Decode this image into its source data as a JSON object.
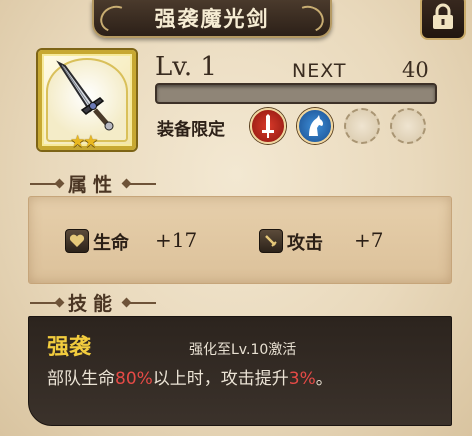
{
  "header": {
    "title": "强袭魔光剑"
  },
  "item": {
    "stars": "★★",
    "level": "Lv. 1",
    "next_label": "NEXT",
    "next_value": "40",
    "exp_progress": 0.0
  },
  "equip": {
    "label": "装备限定",
    "icons": [
      "sword-class-icon",
      "cavalry-class-icon",
      "empty-slot-icon",
      "empty-slot-icon"
    ]
  },
  "attributes": {
    "heading": "属性",
    "hp": {
      "name": "生命",
      "value": "+17"
    },
    "attack": {
      "name": "攻击",
      "value": "+7"
    }
  },
  "skill": {
    "heading": "技能",
    "name": "强袭",
    "unlock": "强化至Lv.10激活",
    "desc_part1": "部队生命",
    "desc_hl1": "80%",
    "desc_part2": "以上时，攻击提升",
    "desc_hl2": "3%",
    "desc_part3": "。"
  },
  "colors": {
    "accent_gold": "#f2cc3e",
    "highlight_red": "#e64a46",
    "dark_panel": "#2c241e"
  }
}
